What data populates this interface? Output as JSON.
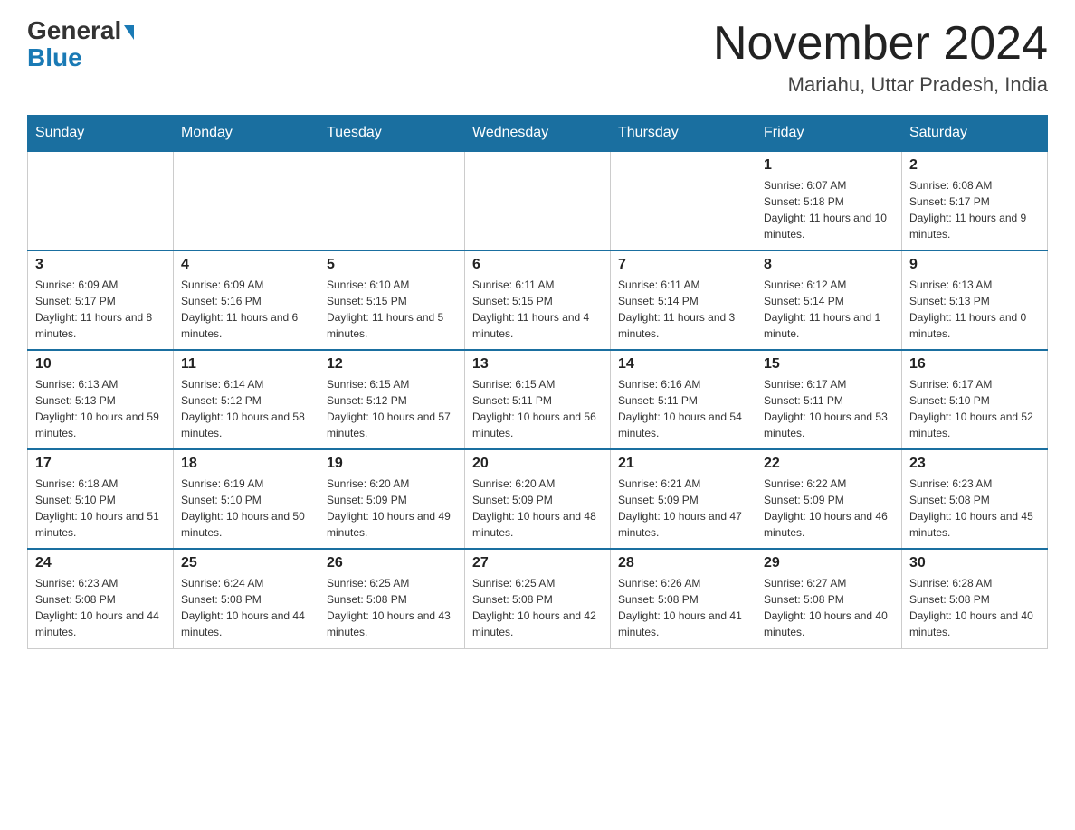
{
  "logo": {
    "general": "General",
    "blue": "Blue"
  },
  "title": "November 2024",
  "location": "Mariahu, Uttar Pradesh, India",
  "weekdays": [
    "Sunday",
    "Monday",
    "Tuesday",
    "Wednesday",
    "Thursday",
    "Friday",
    "Saturday"
  ],
  "weeks": [
    [
      {
        "day": "",
        "sunrise": "",
        "sunset": "",
        "daylight": ""
      },
      {
        "day": "",
        "sunrise": "",
        "sunset": "",
        "daylight": ""
      },
      {
        "day": "",
        "sunrise": "",
        "sunset": "",
        "daylight": ""
      },
      {
        "day": "",
        "sunrise": "",
        "sunset": "",
        "daylight": ""
      },
      {
        "day": "",
        "sunrise": "",
        "sunset": "",
        "daylight": ""
      },
      {
        "day": "1",
        "sunrise": "Sunrise: 6:07 AM",
        "sunset": "Sunset: 5:18 PM",
        "daylight": "Daylight: 11 hours and 10 minutes."
      },
      {
        "day": "2",
        "sunrise": "Sunrise: 6:08 AM",
        "sunset": "Sunset: 5:17 PM",
        "daylight": "Daylight: 11 hours and 9 minutes."
      }
    ],
    [
      {
        "day": "3",
        "sunrise": "Sunrise: 6:09 AM",
        "sunset": "Sunset: 5:17 PM",
        "daylight": "Daylight: 11 hours and 8 minutes."
      },
      {
        "day": "4",
        "sunrise": "Sunrise: 6:09 AM",
        "sunset": "Sunset: 5:16 PM",
        "daylight": "Daylight: 11 hours and 6 minutes."
      },
      {
        "day": "5",
        "sunrise": "Sunrise: 6:10 AM",
        "sunset": "Sunset: 5:15 PM",
        "daylight": "Daylight: 11 hours and 5 minutes."
      },
      {
        "day": "6",
        "sunrise": "Sunrise: 6:11 AM",
        "sunset": "Sunset: 5:15 PM",
        "daylight": "Daylight: 11 hours and 4 minutes."
      },
      {
        "day": "7",
        "sunrise": "Sunrise: 6:11 AM",
        "sunset": "Sunset: 5:14 PM",
        "daylight": "Daylight: 11 hours and 3 minutes."
      },
      {
        "day": "8",
        "sunrise": "Sunrise: 6:12 AM",
        "sunset": "Sunset: 5:14 PM",
        "daylight": "Daylight: 11 hours and 1 minute."
      },
      {
        "day": "9",
        "sunrise": "Sunrise: 6:13 AM",
        "sunset": "Sunset: 5:13 PM",
        "daylight": "Daylight: 11 hours and 0 minutes."
      }
    ],
    [
      {
        "day": "10",
        "sunrise": "Sunrise: 6:13 AM",
        "sunset": "Sunset: 5:13 PM",
        "daylight": "Daylight: 10 hours and 59 minutes."
      },
      {
        "day": "11",
        "sunrise": "Sunrise: 6:14 AM",
        "sunset": "Sunset: 5:12 PM",
        "daylight": "Daylight: 10 hours and 58 minutes."
      },
      {
        "day": "12",
        "sunrise": "Sunrise: 6:15 AM",
        "sunset": "Sunset: 5:12 PM",
        "daylight": "Daylight: 10 hours and 57 minutes."
      },
      {
        "day": "13",
        "sunrise": "Sunrise: 6:15 AM",
        "sunset": "Sunset: 5:11 PM",
        "daylight": "Daylight: 10 hours and 56 minutes."
      },
      {
        "day": "14",
        "sunrise": "Sunrise: 6:16 AM",
        "sunset": "Sunset: 5:11 PM",
        "daylight": "Daylight: 10 hours and 54 minutes."
      },
      {
        "day": "15",
        "sunrise": "Sunrise: 6:17 AM",
        "sunset": "Sunset: 5:11 PM",
        "daylight": "Daylight: 10 hours and 53 minutes."
      },
      {
        "day": "16",
        "sunrise": "Sunrise: 6:17 AM",
        "sunset": "Sunset: 5:10 PM",
        "daylight": "Daylight: 10 hours and 52 minutes."
      }
    ],
    [
      {
        "day": "17",
        "sunrise": "Sunrise: 6:18 AM",
        "sunset": "Sunset: 5:10 PM",
        "daylight": "Daylight: 10 hours and 51 minutes."
      },
      {
        "day": "18",
        "sunrise": "Sunrise: 6:19 AM",
        "sunset": "Sunset: 5:10 PM",
        "daylight": "Daylight: 10 hours and 50 minutes."
      },
      {
        "day": "19",
        "sunrise": "Sunrise: 6:20 AM",
        "sunset": "Sunset: 5:09 PM",
        "daylight": "Daylight: 10 hours and 49 minutes."
      },
      {
        "day": "20",
        "sunrise": "Sunrise: 6:20 AM",
        "sunset": "Sunset: 5:09 PM",
        "daylight": "Daylight: 10 hours and 48 minutes."
      },
      {
        "day": "21",
        "sunrise": "Sunrise: 6:21 AM",
        "sunset": "Sunset: 5:09 PM",
        "daylight": "Daylight: 10 hours and 47 minutes."
      },
      {
        "day": "22",
        "sunrise": "Sunrise: 6:22 AM",
        "sunset": "Sunset: 5:09 PM",
        "daylight": "Daylight: 10 hours and 46 minutes."
      },
      {
        "day": "23",
        "sunrise": "Sunrise: 6:23 AM",
        "sunset": "Sunset: 5:08 PM",
        "daylight": "Daylight: 10 hours and 45 minutes."
      }
    ],
    [
      {
        "day": "24",
        "sunrise": "Sunrise: 6:23 AM",
        "sunset": "Sunset: 5:08 PM",
        "daylight": "Daylight: 10 hours and 44 minutes."
      },
      {
        "day": "25",
        "sunrise": "Sunrise: 6:24 AM",
        "sunset": "Sunset: 5:08 PM",
        "daylight": "Daylight: 10 hours and 44 minutes."
      },
      {
        "day": "26",
        "sunrise": "Sunrise: 6:25 AM",
        "sunset": "Sunset: 5:08 PM",
        "daylight": "Daylight: 10 hours and 43 minutes."
      },
      {
        "day": "27",
        "sunrise": "Sunrise: 6:25 AM",
        "sunset": "Sunset: 5:08 PM",
        "daylight": "Daylight: 10 hours and 42 minutes."
      },
      {
        "day": "28",
        "sunrise": "Sunrise: 6:26 AM",
        "sunset": "Sunset: 5:08 PM",
        "daylight": "Daylight: 10 hours and 41 minutes."
      },
      {
        "day": "29",
        "sunrise": "Sunrise: 6:27 AM",
        "sunset": "Sunset: 5:08 PM",
        "daylight": "Daylight: 10 hours and 40 minutes."
      },
      {
        "day": "30",
        "sunrise": "Sunrise: 6:28 AM",
        "sunset": "Sunset: 5:08 PM",
        "daylight": "Daylight: 10 hours and 40 minutes."
      }
    ]
  ]
}
